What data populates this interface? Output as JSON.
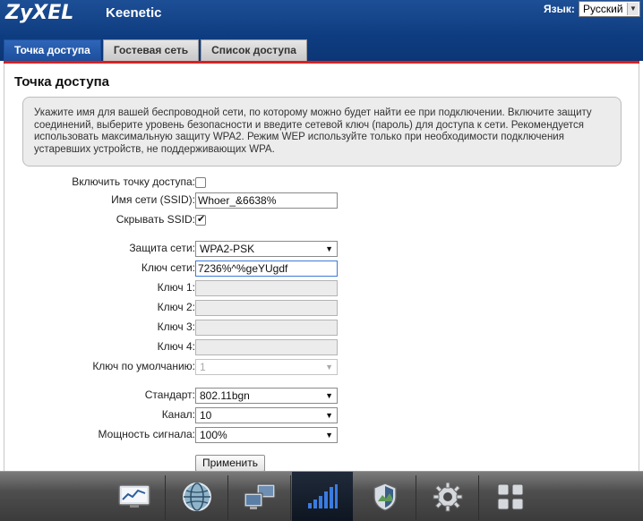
{
  "header": {
    "logo": "ZyXEL",
    "product": "Keenetic",
    "lang_label": "Язык:",
    "lang_value": "Русский"
  },
  "tabs": [
    {
      "label": "Точка доступа",
      "active": true
    },
    {
      "label": "Гостевая сеть",
      "active": false
    },
    {
      "label": "Список доступа",
      "active": false
    }
  ],
  "page": {
    "title": "Точка доступа",
    "info": "Укажите имя для вашей беспроводной сети, по которому можно будет найти ее при подключении. Включите защиту соединений, выберите уровень безопасности и введите сетевой ключ (пароль) для доступа к сети. Рекомендуется использовать максимальную защиту WPA2. Режим WEP используйте только при необходимости подключения устаревших устройств, не поддерживающих WPA."
  },
  "form": {
    "enable_label": "Включить точку доступа:",
    "ssid_label": "Имя сети (SSID):",
    "ssid_value": "Whoer_&6638%",
    "hide_ssid_label": "Скрывать SSID:",
    "hide_ssid_checked": true,
    "security_label": "Защита сети:",
    "security_value": "WPA2-PSK",
    "key_label": "Ключ сети:",
    "key_value": "7236%^%geYUgdf",
    "key1_label": "Ключ 1:",
    "key2_label": "Ключ 2:",
    "key3_label": "Ключ 3:",
    "key4_label": "Ключ 4:",
    "default_key_label": "Ключ по умолчанию:",
    "default_key_value": "1",
    "standard_label": "Стандарт:",
    "standard_value": "802.11bgn",
    "channel_label": "Канал:",
    "channel_value": "10",
    "power_label": "Мощность сигнала:",
    "power_value": "100%",
    "apply_label": "Применить"
  },
  "dock": {
    "items": [
      {
        "icon": "monitor-chart-icon",
        "active": false
      },
      {
        "icon": "globe-icon",
        "active": false
      },
      {
        "icon": "network-computers-icon",
        "active": false
      },
      {
        "icon": "wifi-signal-bars-icon",
        "active": true
      },
      {
        "icon": "shield-icon",
        "active": false
      },
      {
        "icon": "gear-icon",
        "active": false
      },
      {
        "icon": "apps-grid-icon",
        "active": false
      }
    ]
  },
  "colors": {
    "header_blue": "#0e3c80",
    "accent_red": "#d32323",
    "tab_active": "#1c4f9c"
  }
}
